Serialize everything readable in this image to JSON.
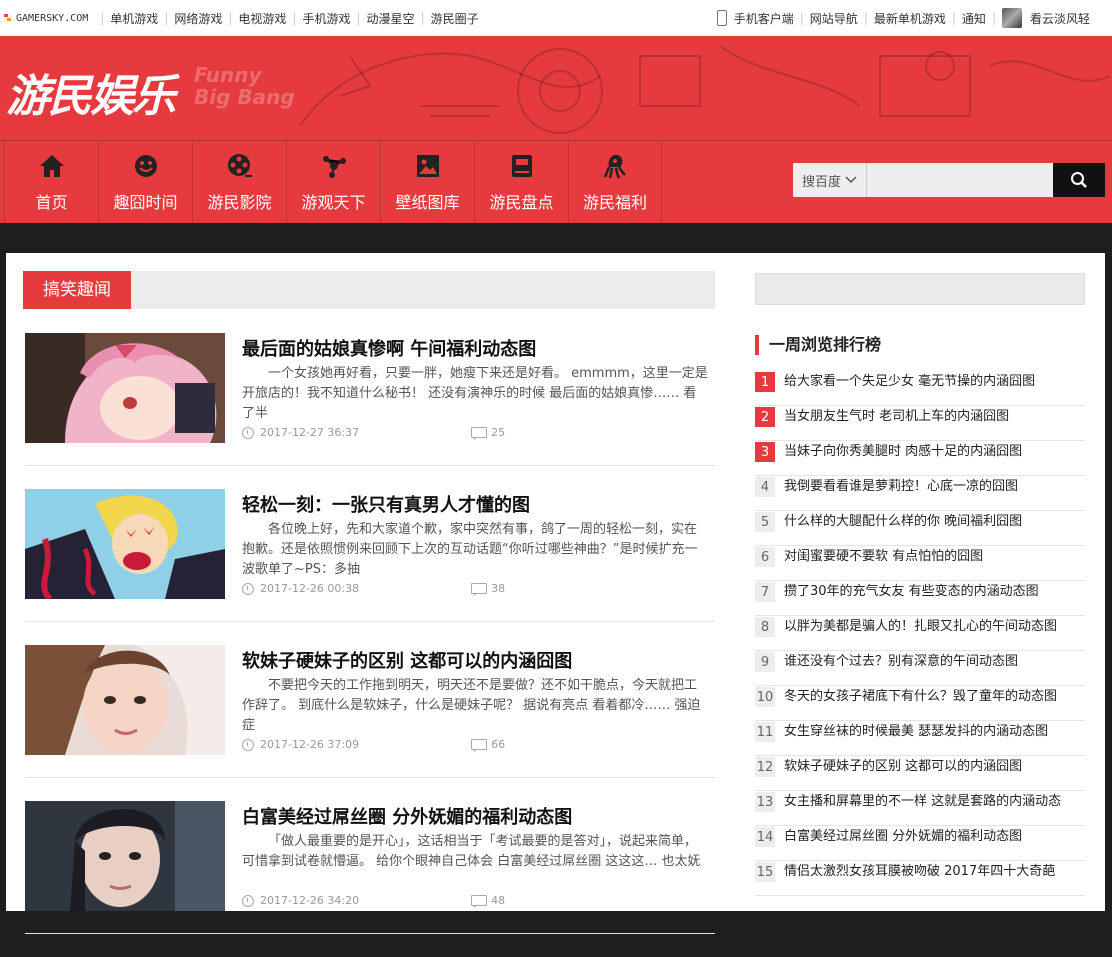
{
  "topbar": {
    "site": "GAMERSKY.COM",
    "links": [
      "单机游戏",
      "网络游戏",
      "电视游戏",
      "手机游戏",
      "动漫星空",
      "游民圈子"
    ],
    "right_links": [
      "手机客户端",
      "网站导航",
      "最新单机游戏",
      "通知"
    ],
    "username": "看云淡风轻"
  },
  "header": {
    "brand": "游民娱乐",
    "brand_en_1": "Funny",
    "brand_en_2": "Big Bang",
    "nav": [
      {
        "label": "首页",
        "icon": "home-icon"
      },
      {
        "label": "趣囧时间",
        "icon": "smile-icon"
      },
      {
        "label": "游民影院",
        "icon": "film-reel-icon"
      },
      {
        "label": "游观天下",
        "icon": "molecule-icon"
      },
      {
        "label": "壁纸图库",
        "icon": "picture-icon"
      },
      {
        "label": "游民盘点",
        "icon": "book-icon"
      },
      {
        "label": "游民福利",
        "icon": "octopus-icon"
      }
    ],
    "search": {
      "scope": "搜百度",
      "placeholder": ""
    }
  },
  "section": {
    "title": "搞笑趣闻"
  },
  "articles": [
    {
      "title": "最后面的姑娘真惨啊 午间福利动态图",
      "desc": "一个女孩她再好看，只要一胖，她瘦下来还是好看。 emmmm，这里一定是开旅店的！我不知道什么秘书！ 还没有演神乐的时候 最后面的姑娘真惨…… 看了半",
      "date": "2017-12-27 36:37",
      "comments": "25"
    },
    {
      "title": "轻松一刻：一张只有真男人才懂的图",
      "desc": "各位晚上好，先和大家道个歉，家中突然有事，鸽了一周的轻松一刻，实在抱歉。还是依照惯例来回顾下上次的互动话题“你听过哪些神曲？”是时候扩充一波歌单了~PS：多抽",
      "date": "2017-12-26 00:38",
      "comments": "38"
    },
    {
      "title": "软妹子硬妹子的区别 这都可以的内涵囧图",
      "desc": "不要把今天的工作拖到明天，明天还不是要做？还不如干脆点，今天就把工作辞了。 到底什么是软妹子，什么是硬妹子呢？ 据说有亮点 看着都冷…… 强迫症",
      "date": "2017-12-26 37:09",
      "comments": "66"
    },
    {
      "title": "白富美经过屌丝圈 分外妩媚的福利动态图",
      "desc": "「做人最重要的是开心」，这话相当于「考试最要的是答对」，说起来简单，可惜拿到试卷就懵逼。 给你个眼神自己体会 白富美经过屌丝圈 这这这… 也太妩",
      "date": "2017-12-26 34:20",
      "comments": "48"
    }
  ],
  "sidebar": {
    "rank_title": "一周浏览排行榜",
    "ranks": [
      "给大家看一个失足少女 毫无节操的内涵囧图",
      "当女朋友生气时 老司机上车的内涵囧图",
      "当妹子向你秀美腿时 肉感十足的内涵囧图",
      "我倒要看看谁是萝莉控！心底一凉的囧图",
      "什么样的大腿配什么样的你 晚间福利囧图",
      "对闺蜜要硬不要软 有点怕怕的囧图",
      "攒了30年的充气女友 有些变态的内涵动态图",
      "以胖为美都是骗人的！扎眼又扎心的午间动态图",
      "谁还没有个过去？别有深意的午间动态图",
      "冬天的女孩子裙底下有什么？毁了童年的动态图",
      "女生穿丝袜的时候最美 瑟瑟发抖的内涵动态图",
      "软妹子硬妹子的区别 这都可以的内涵囧图",
      "女主播和屏幕里的不一样 这就是套路的内涵动态",
      "白富美经过屌丝圈 分外妩媚的福利动态图",
      "情侣太激烈女孩耳膜被吻破 2017年四十大奇葩"
    ],
    "rank_numbers": [
      "1",
      "2",
      "3",
      "4",
      "5",
      "6",
      "7",
      "8",
      "9",
      "10",
      "11",
      "12",
      "13",
      "14",
      "15"
    ]
  },
  "colors": {
    "accent": "#e53b3f",
    "dark": "#1e1e1e"
  }
}
